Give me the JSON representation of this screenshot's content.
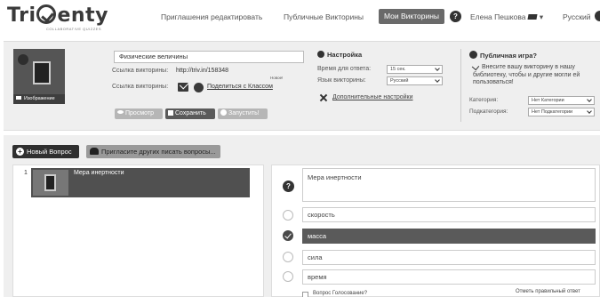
{
  "logo": {
    "left": "Tri",
    "right": "enty",
    "subtitle": "COLLABORATIVE QUIZZES"
  },
  "nav": {
    "invitations": "Приглашения редактировать",
    "public": "Публичные Викторины",
    "my": "Мои Викторины",
    "help": "?",
    "user": "Елена Пешкова",
    "language": "Русский"
  },
  "quiz": {
    "image_label": "Изображение",
    "title_value": "Физические величины",
    "link_label": "Ссылка викторины:",
    "link_value": "http://triv.in/158348",
    "new_tag": "Новое!",
    "link_label_2": "Ссылка викторины:",
    "share_classroom": "Поделиться с Классом",
    "preview": "Просмотр",
    "save": "Сохранить",
    "run": "Запустить!"
  },
  "settings": {
    "title": "Настройка",
    "time_label": "Время для ответа:",
    "time_value": "15 сек.",
    "lang_label": "Язык викторины:",
    "lang_value": "Русский",
    "advanced": "Дополнительные настройки"
  },
  "public": {
    "title": "Публичная игра?",
    "text": "Внесите вашу викторину в нашу библиотеку, чтобы и другие могли ей пользоваться!",
    "category_label": "Категория:",
    "category_value": "Нет Категории",
    "subcategory_label": "Подкатегория:",
    "subcategory_value": "Нет Подкатегории"
  },
  "editor": {
    "new_question": "Новый Вопрос",
    "invite": "Пригласите других писать вопросы..."
  },
  "questions": [
    {
      "num": "1",
      "text": "Мера инертности"
    }
  ],
  "current": {
    "question": "Мера инертности",
    "answers": [
      {
        "text": "скорость",
        "selected": false
      },
      {
        "text": "масса",
        "selected": true
      },
      {
        "text": "сила",
        "selected": false
      },
      {
        "text": "время",
        "selected": false
      }
    ],
    "poll_label": "Вопрос Голосование?",
    "mark_label": "Отметь правильный ответ"
  }
}
